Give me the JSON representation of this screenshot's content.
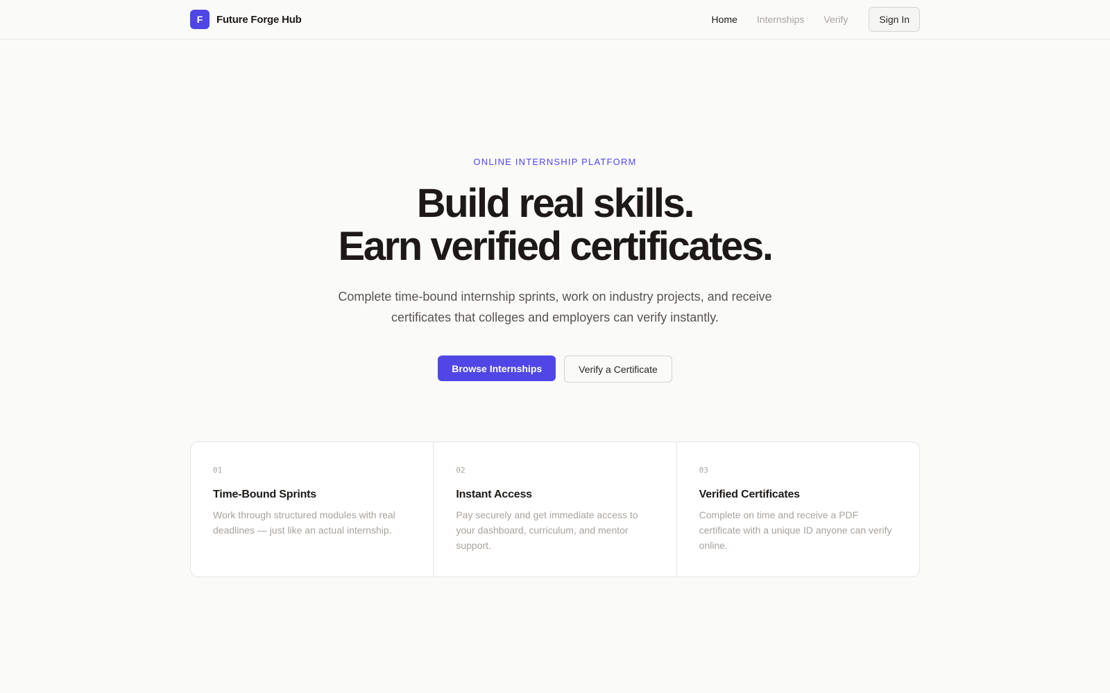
{
  "nav": {
    "brand_initial": "F",
    "brand_name": "Future Forge Hub",
    "links": [
      {
        "label": "Home"
      },
      {
        "label": "Internships"
      },
      {
        "label": "Verify"
      }
    ],
    "signin_label": "Sign In"
  },
  "hero": {
    "eyebrow": "ONLINE INTERNSHIP PLATFORM",
    "headline_line1": "Build real skills.",
    "headline_line2": "Earn verified certificates.",
    "subtitle": "Complete time-bound internship sprints, work on industry projects, and receive certificates that colleges and employers can verify instantly.",
    "primary_cta": "Browse Internships",
    "secondary_cta": "Verify a Certificate"
  },
  "features": [
    {
      "num": "01",
      "title": "Time-Bound Sprints",
      "desc": "Work through structured modules with real deadlines — just like an actual internship."
    },
    {
      "num": "02",
      "title": "Instant Access",
      "desc": "Pay securely and get immediate access to your dashboard, curriculum, and mentor support."
    },
    {
      "num": "03",
      "title": "Verified Certificates",
      "desc": "Complete on time and receive a PDF certificate with a unique ID anyone can verify online."
    }
  ],
  "colors": {
    "accent": "#4f46e5",
    "background": "#fafaf9",
    "text": "#1c1917",
    "muted": "#a8a29e"
  }
}
